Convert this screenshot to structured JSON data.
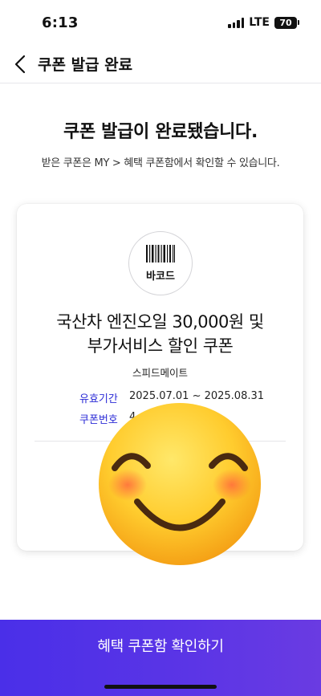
{
  "status_bar": {
    "time": "6:13",
    "network": "LTE",
    "battery": "70"
  },
  "nav": {
    "title": "쿠폰 발급 완료"
  },
  "main": {
    "headline": "쿠폰 발급이 완료됐습니다.",
    "subtext": "받은 쿠폰은 MY > 혜택 쿠폰함에서 확인할 수 있습니다."
  },
  "coupon": {
    "barcode_label": "바코드",
    "title_line1": "국산차 엔진오일 30,000원 및",
    "title_line2": "부가서비스 할인 쿠폰",
    "brand": "스피드메이트",
    "validity_label": "유효기간",
    "validity_value": "2025.07.01 ~ 2025.08.31",
    "number_label": "쿠폰번호",
    "number_value": "4"
  },
  "cta": {
    "label": "혜택 쿠폰함 확인하기"
  },
  "overlay": {
    "icon": "smiling-face-emoji-icon"
  },
  "colors": {
    "accent": "#4a2fe8",
    "label_blue": "#2b2bd6"
  }
}
